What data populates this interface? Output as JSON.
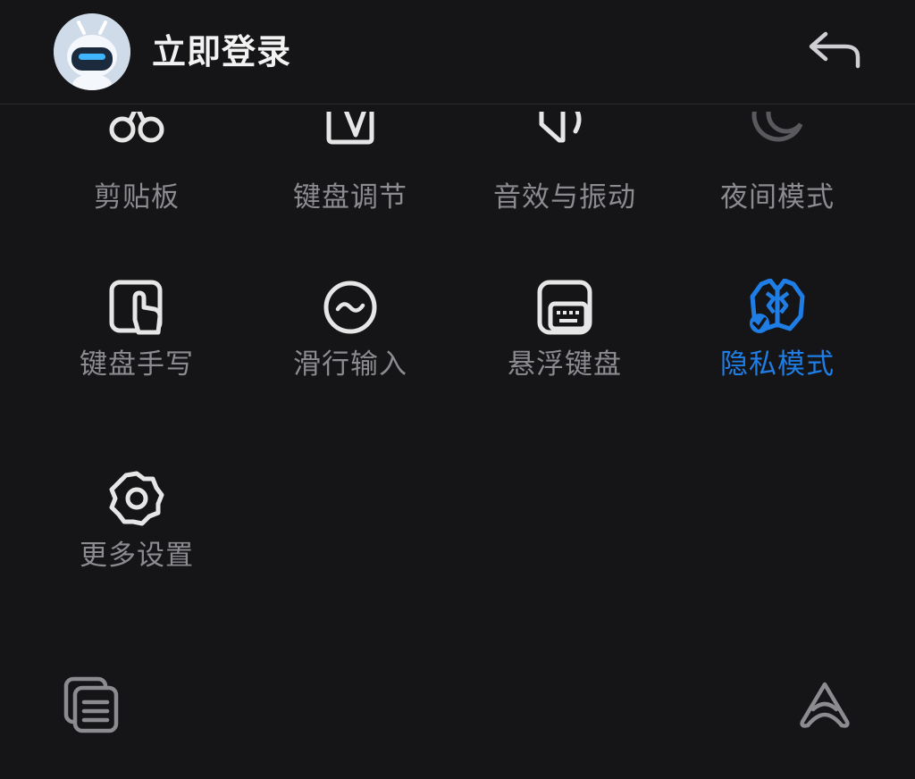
{
  "header": {
    "login_label": "立即登录",
    "avatar_icon": "robot-avatar-icon",
    "back_icon": "return-arrow-icon"
  },
  "grid": {
    "items": [
      {
        "label": "剪贴板",
        "icon": "scissors-icon"
      },
      {
        "label": "键盘调节",
        "icon": "keyboard-adjust-icon"
      },
      {
        "label": "音效与振动",
        "icon": "sound-vibration-icon"
      },
      {
        "label": "夜间模式",
        "icon": "moon-icon"
      },
      {
        "label": "键盘手写",
        "icon": "handwriting-icon"
      },
      {
        "label": "滑行输入",
        "icon": "swipe-input-icon"
      },
      {
        "label": "悬浮键盘",
        "icon": "floating-keyboard-icon"
      },
      {
        "label": "隐私模式",
        "icon": "privacy-mode-icon",
        "active": true
      },
      {
        "label": "更多设置",
        "icon": "gear-icon"
      }
    ]
  },
  "footer": {
    "left_icon": "clipboard-list-icon",
    "right_icon": "brand-logo-icon"
  },
  "colors": {
    "background": "#151518",
    "text_muted": "#8b8b90",
    "text_primary": "#f2f2f2",
    "accent": "#1e7ee6"
  }
}
